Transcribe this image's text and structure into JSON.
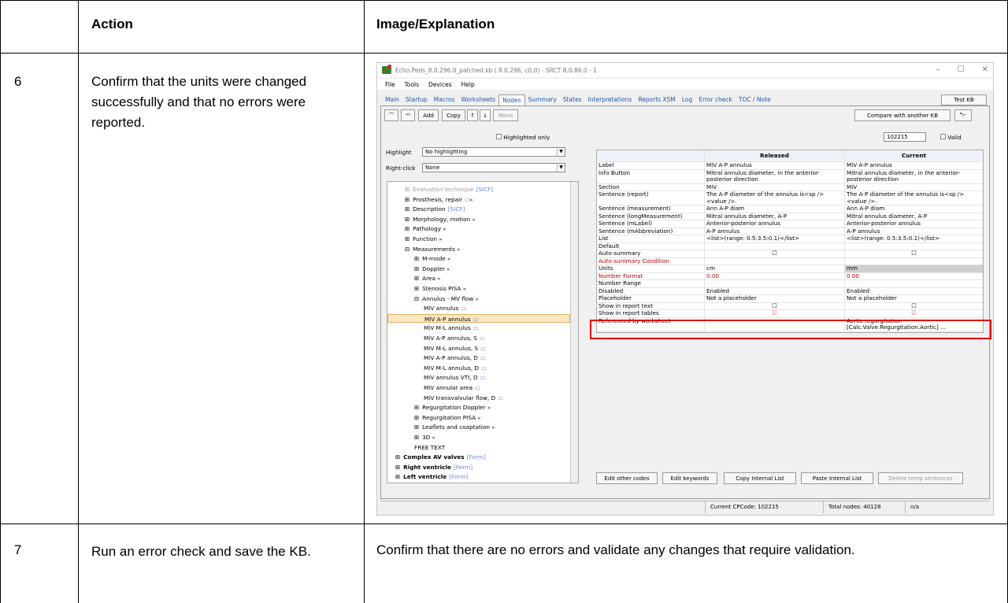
{
  "table": {
    "headers": {
      "col1": "",
      "col2": "Action",
      "col3": "Image/Explanation"
    },
    "rows": [
      {
        "num": "6",
        "action": "Confirm that the units were changed successfully and that no errors were reported.",
        "explanation": ""
      },
      {
        "num": "7",
        "action": "Run an error check and save the KB.",
        "explanation": "Confirm that there are no errors and validate any changes that require validation."
      }
    ]
  },
  "app": {
    "title": "Echo.Peds_8.0.296.0_patched.kb ( 8.0.296, c0.0) - SRCT 8.0.86.0 - 1",
    "window_controls": [
      "–",
      "☐",
      "✕"
    ],
    "menu": [
      "File",
      "Tools",
      "Devices",
      "Help"
    ],
    "tabs": [
      "Main",
      "Startup",
      "Macros",
      "Worksheets",
      "Nodes",
      "Summary",
      "States",
      "Interpretations",
      "Reports XSM",
      "Log",
      "Error check",
      "TOC / Note"
    ],
    "active_tab": "Nodes",
    "test_kb": "Test KB",
    "toolbar": {
      "b1": "⌒",
      "b2": "⁰⁰",
      "add": "Add",
      "copy": "Copy",
      "up": "↑",
      "down": "↓",
      "move": "Move"
    },
    "compare": "Compare with another KB",
    "binoculars": "🔭",
    "highlighted_only": "Highlighted only",
    "code_value": "102215",
    "valid": "Valid",
    "highlight_label": "Highlight",
    "highlight_value": "No highlighting",
    "rightclick_label": "Right-click",
    "rightclick_value": "None",
    "tree": [
      {
        "t": "Evaluation technique",
        "tag": "[SICF]",
        "ind": 0,
        "box": "⊞",
        "gray": true
      },
      {
        "t": "Prosthesis, repair",
        "tag": "▭▸",
        "ind": 0,
        "box": "⊞"
      },
      {
        "t": "Description",
        "tag": "[SICF]",
        "ind": 0,
        "box": "⊞"
      },
      {
        "t": "Morphology, motion",
        "tag": "▸",
        "ind": 0,
        "box": "⊞"
      },
      {
        "t": "Pathology",
        "tag": "▸",
        "ind": 0,
        "box": "⊞"
      },
      {
        "t": "Function",
        "tag": "▸",
        "ind": 0,
        "box": "⊞"
      },
      {
        "t": "Measurements",
        "tag": "▸",
        "ind": 0,
        "box": "⊟"
      },
      {
        "t": "M-mode",
        "tag": "▸",
        "ind": 1,
        "box": "⊞"
      },
      {
        "t": "Doppler",
        "tag": "▸",
        "ind": 1,
        "box": "⊞"
      },
      {
        "t": "Area",
        "tag": "▸",
        "ind": 1,
        "box": "⊞"
      },
      {
        "t": "Stenosis PISA",
        "tag": "▸",
        "ind": 1,
        "box": "⊞"
      },
      {
        "t": "Annulus - MV flow",
        "tag": "▸",
        "ind": 1,
        "box": "⊟"
      },
      {
        "t": "MiV annulus",
        "tag": "▭",
        "ind": 2,
        "box": ""
      },
      {
        "t": "MiV A-P annulus",
        "tag": "▭",
        "ind": 2,
        "box": "",
        "sel": true
      },
      {
        "t": "MiV M-L annulus",
        "tag": "▭",
        "ind": 2,
        "box": ""
      },
      {
        "t": "MiV A-P annulus, S",
        "tag": "▭",
        "ind": 2,
        "box": ""
      },
      {
        "t": "MiV M-L annulus, S",
        "tag": "▭",
        "ind": 2,
        "box": ""
      },
      {
        "t": "MiV A-P annulus, D",
        "tag": "▭",
        "ind": 2,
        "box": ""
      },
      {
        "t": "MiV M-L annulus, D",
        "tag": "▭",
        "ind": 2,
        "box": ""
      },
      {
        "t": "MiV annulus VTI, D",
        "tag": "▭",
        "ind": 2,
        "box": ""
      },
      {
        "t": "MiV annular area",
        "tag": "▭",
        "ind": 2,
        "box": ""
      },
      {
        "t": "MiV transvalvular flow, D",
        "tag": "▭",
        "ind": 2,
        "box": ""
      },
      {
        "t": "Regurgitation Doppler",
        "tag": "▸",
        "ind": 1,
        "box": "⊞"
      },
      {
        "t": "Regurgitation PISA",
        "tag": "▸",
        "ind": 1,
        "box": "⊞"
      },
      {
        "t": "Leaflets and coaptation",
        "tag": "▸",
        "ind": 1,
        "box": "⊞"
      },
      {
        "t": "3D",
        "tag": "▸",
        "ind": 1,
        "box": "⊞"
      },
      {
        "t": "FREE TEXT",
        "tag": "",
        "ind": 1,
        "box": ""
      },
      {
        "t": "Complex AV valves",
        "tag": "[Form]",
        "ind": -1,
        "box": "⊞",
        "bold": true
      },
      {
        "t": "Right ventricle",
        "tag": "[Form]",
        "ind": -1,
        "box": "⊞",
        "bold": true
      },
      {
        "t": "Left ventricle",
        "tag": "[Form]",
        "ind": -1,
        "box": "⊞",
        "bold": true
      }
    ],
    "grid_headers": [
      "",
      "Released",
      "Current"
    ],
    "grid": [
      {
        "k": "Label",
        "r": "MiV A-P annulus",
        "c": "MiV A-P annulus"
      },
      {
        "k": "Info Button",
        "r": "Mitral annulus diameter, in the anterior-posterior direction",
        "c": "Mitral annulus diameter, in the anterior-posterior direction"
      },
      {
        "k": "Section",
        "r": "MiV",
        "c": "MiV"
      },
      {
        "k": "Sentence (report)",
        "r": "The A-P diameter of the annulus is<sp /><value />.",
        "c": "The A-P diameter of the annulus is<sp /><value />."
      },
      {
        "k": "Sentence (measurement)",
        "r": "Ann A-P diam",
        "c": "Ann A-P diam"
      },
      {
        "k": "Sentence (longMeasurement)",
        "r": "Mitral annulus diameter, A-P",
        "c": "Mitral annulus diameter, A-P"
      },
      {
        "k": "Sentence (mLabel)",
        "r": "Anterior-posterior annulus",
        "c": "Anterior-posterior annulus"
      },
      {
        "k": "Sentence (mAbbreviation)",
        "r": "A-P annulus",
        "c": "A-P annulus"
      },
      {
        "k": "List",
        "r": "<list>(range: 0.5:3.5:0.1)</list>",
        "c": "<list>(range: 0.5:3.5:0.1)</list>"
      },
      {
        "k": "Default",
        "r": "",
        "c": ""
      },
      {
        "k": "Auto-summary",
        "r": "☐",
        "c": "☐"
      },
      {
        "k": "Auto-summary Condition",
        "r": "",
        "c": ""
      },
      {
        "k": "Units",
        "r": "cm",
        "c": "mm"
      },
      {
        "k": "Number Format",
        "r": "0.00",
        "c": "0.00"
      },
      {
        "k": "Number Range",
        "r": "",
        "c": ""
      },
      {
        "k": "Disabled",
        "r": "Enabled",
        "c": "Enabled"
      },
      {
        "k": "Placeholder",
        "r": "Not a placeholder",
        "c": "Not a placeholder"
      },
      {
        "k": "Show in report text",
        "r": "☐",
        "c": "☐"
      },
      {
        "k": "Show in report tables",
        "r": "☑",
        "c": "☑"
      },
      {
        "k": "Referenced by worksheet",
        "r": "",
        "c": "Aortic regurgitation [Calc.Valve.Regurgitation.Aortic] ..."
      }
    ],
    "bottom_buttons": [
      "Edit other codes",
      "Edit keywords",
      "Copy Internal List",
      "Paste Internal List",
      "Delete temp sentences"
    ],
    "status": {
      "cpcode": "Current CPCode:  102215",
      "nodes": "Total nodes:  40128",
      "na": "n/a"
    }
  }
}
